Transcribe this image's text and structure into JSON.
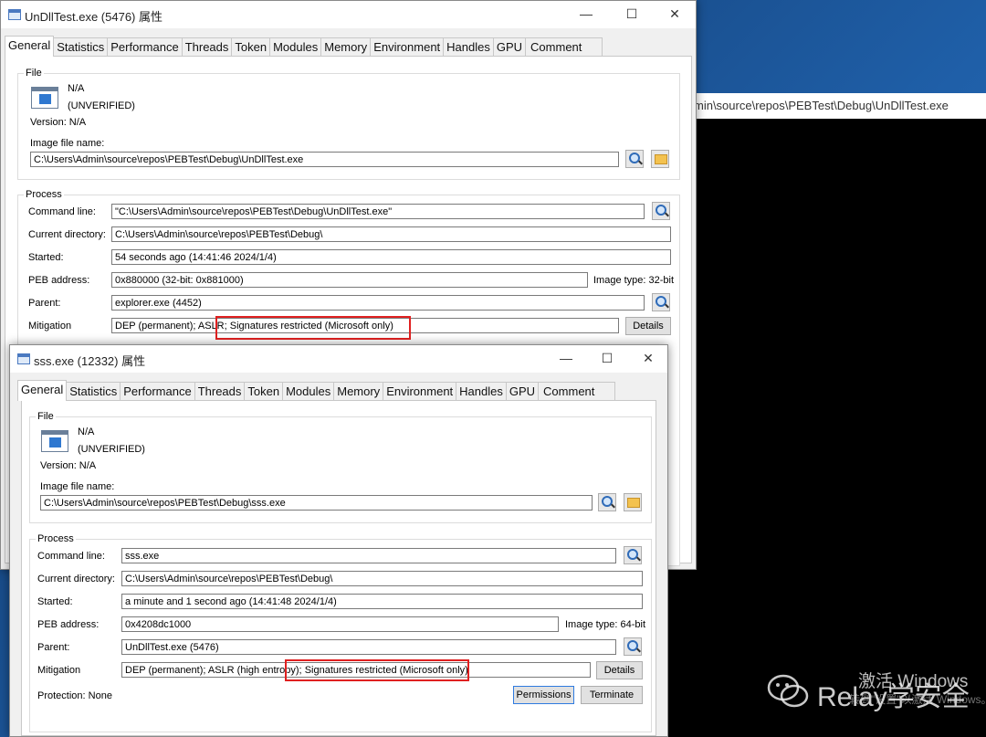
{
  "background_window": {
    "title": "min\\source\\repos\\PEBTest\\Debug\\UnDllTest.exe"
  },
  "window1": {
    "title": "UnDllTest.exe (5476) 属性",
    "tabs": [
      "General",
      "Statistics",
      "Performance",
      "Threads",
      "Token",
      "Modules",
      "Memory",
      "Environment",
      "Handles",
      "GPU",
      "Comment"
    ],
    "file": {
      "group": "File",
      "name": "N/A",
      "verified": "(UNVERIFIED)",
      "version": "Version: N/A",
      "image_label": "Image file name:",
      "image_path": "C:\\Users\\Admin\\source\\repos\\PEBTest\\Debug\\UnDllTest.exe"
    },
    "process": {
      "group": "Process",
      "command_line_label": "Command line:",
      "command_line": "\"C:\\Users\\Admin\\source\\repos\\PEBTest\\Debug\\UnDllTest.exe\"",
      "cwd_label": "Current directory:",
      "cwd": "C:\\Users\\Admin\\source\\repos\\PEBTest\\Debug\\",
      "started_label": "Started:",
      "started": "54 seconds ago (14:41:46 2024/1/4)",
      "peb_label": "PEB address:",
      "peb": "0x880000 (32-bit: 0x881000)",
      "image_type": "Image type: 32-bit",
      "parent_label": "Parent:",
      "parent": "explorer.exe (4452)",
      "mitigation_label": "Mitigation",
      "mitigation_a": "DEP (permanent); ASLR;",
      "mitigation_b": "Signatures restricted (Microsoft only)",
      "details": "Details"
    }
  },
  "window2": {
    "title": "sss.exe (12332) 属性",
    "tabs": [
      "General",
      "Statistics",
      "Performance",
      "Threads",
      "Token",
      "Modules",
      "Memory",
      "Environment",
      "Handles",
      "GPU",
      "Comment"
    ],
    "file": {
      "group": "File",
      "name": "N/A",
      "verified": "(UNVERIFIED)",
      "version": "Version: N/A",
      "image_label": "Image file name:",
      "image_path": "C:\\Users\\Admin\\source\\repos\\PEBTest\\Debug\\sss.exe"
    },
    "process": {
      "group": "Process",
      "command_line_label": "Command line:",
      "command_line": "sss.exe",
      "cwd_label": "Current directory:",
      "cwd": "C:\\Users\\Admin\\source\\repos\\PEBTest\\Debug\\",
      "started_label": "Started:",
      "started": "a minute and 1 second ago (14:41:48 2024/1/4)",
      "peb_label": "PEB address:",
      "peb": "0x4208dc1000",
      "image_type": "Image type: 64-bit",
      "parent_label": "Parent:",
      "parent": "UnDllTest.exe (5476)",
      "mitigation_label": "Mitigation",
      "mitigation_a": "DEP (permanent); ASLR (high entropy);",
      "mitigation_b": "Signatures restricted (Microsoft only)",
      "details": "Details",
      "protection": "Protection: None",
      "permissions": "Permissions",
      "terminate": "Terminate"
    }
  },
  "watermark": {
    "activate": "激活 Windows",
    "activate_sub": "转到\"设置\"以激活 Windows。",
    "brand": "Relay学安全"
  }
}
